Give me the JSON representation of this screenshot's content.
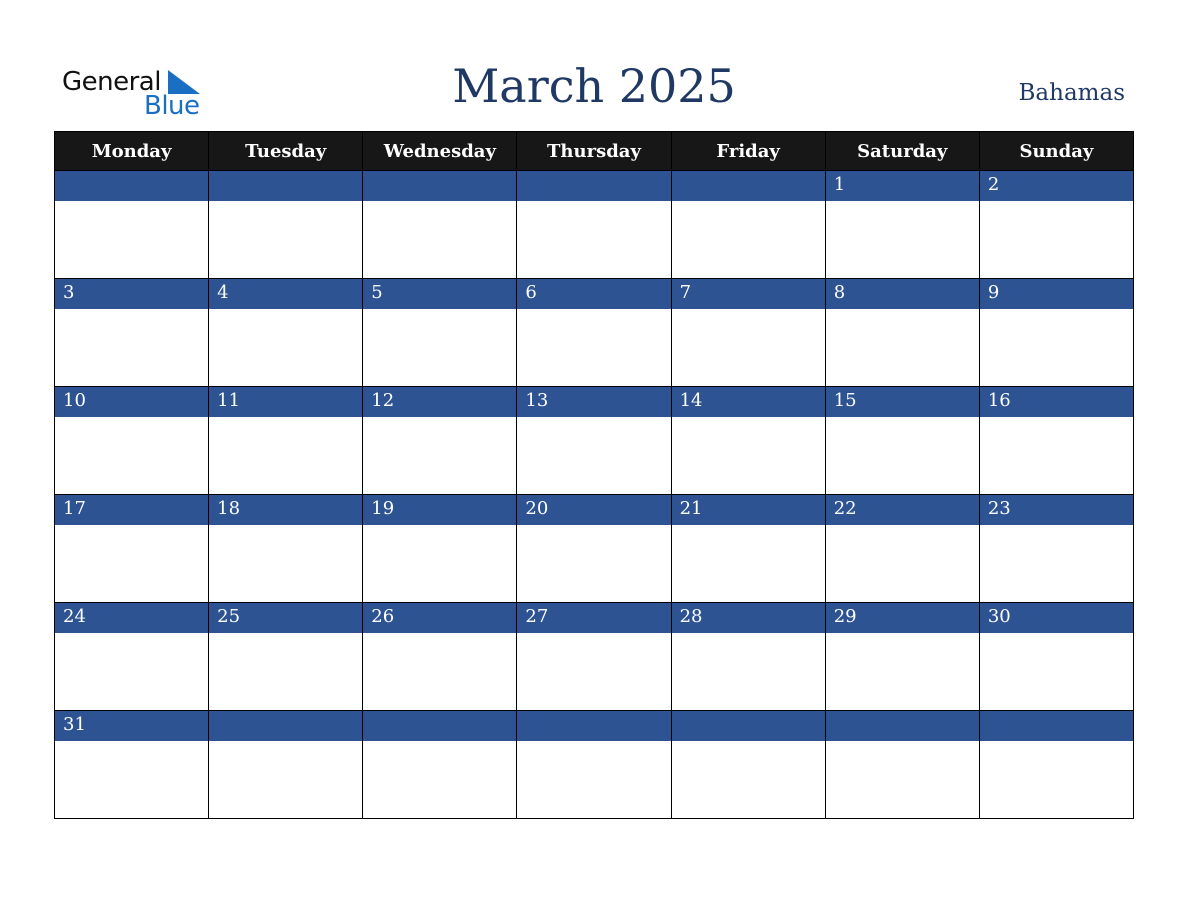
{
  "logo": {
    "word1": "General",
    "word2": "Blue",
    "icon": "triangle-flag-icon"
  },
  "title": "March 2025",
  "country": "Bahamas",
  "colors": {
    "header_bg": "#171717",
    "day_bar": "#2d5393",
    "title": "#1f3864",
    "logo_blue": "#1a6fc2"
  },
  "weekdays": [
    "Monday",
    "Tuesday",
    "Wednesday",
    "Thursday",
    "Friday",
    "Saturday",
    "Sunday"
  ],
  "weeks": [
    [
      "",
      "",
      "",
      "",
      "",
      "1",
      "2"
    ],
    [
      "3",
      "4",
      "5",
      "6",
      "7",
      "8",
      "9"
    ],
    [
      "10",
      "11",
      "12",
      "13",
      "14",
      "15",
      "16"
    ],
    [
      "17",
      "18",
      "19",
      "20",
      "21",
      "22",
      "23"
    ],
    [
      "24",
      "25",
      "26",
      "27",
      "28",
      "29",
      "30"
    ],
    [
      "31",
      "",
      "",
      "",
      "",
      "",
      ""
    ]
  ]
}
